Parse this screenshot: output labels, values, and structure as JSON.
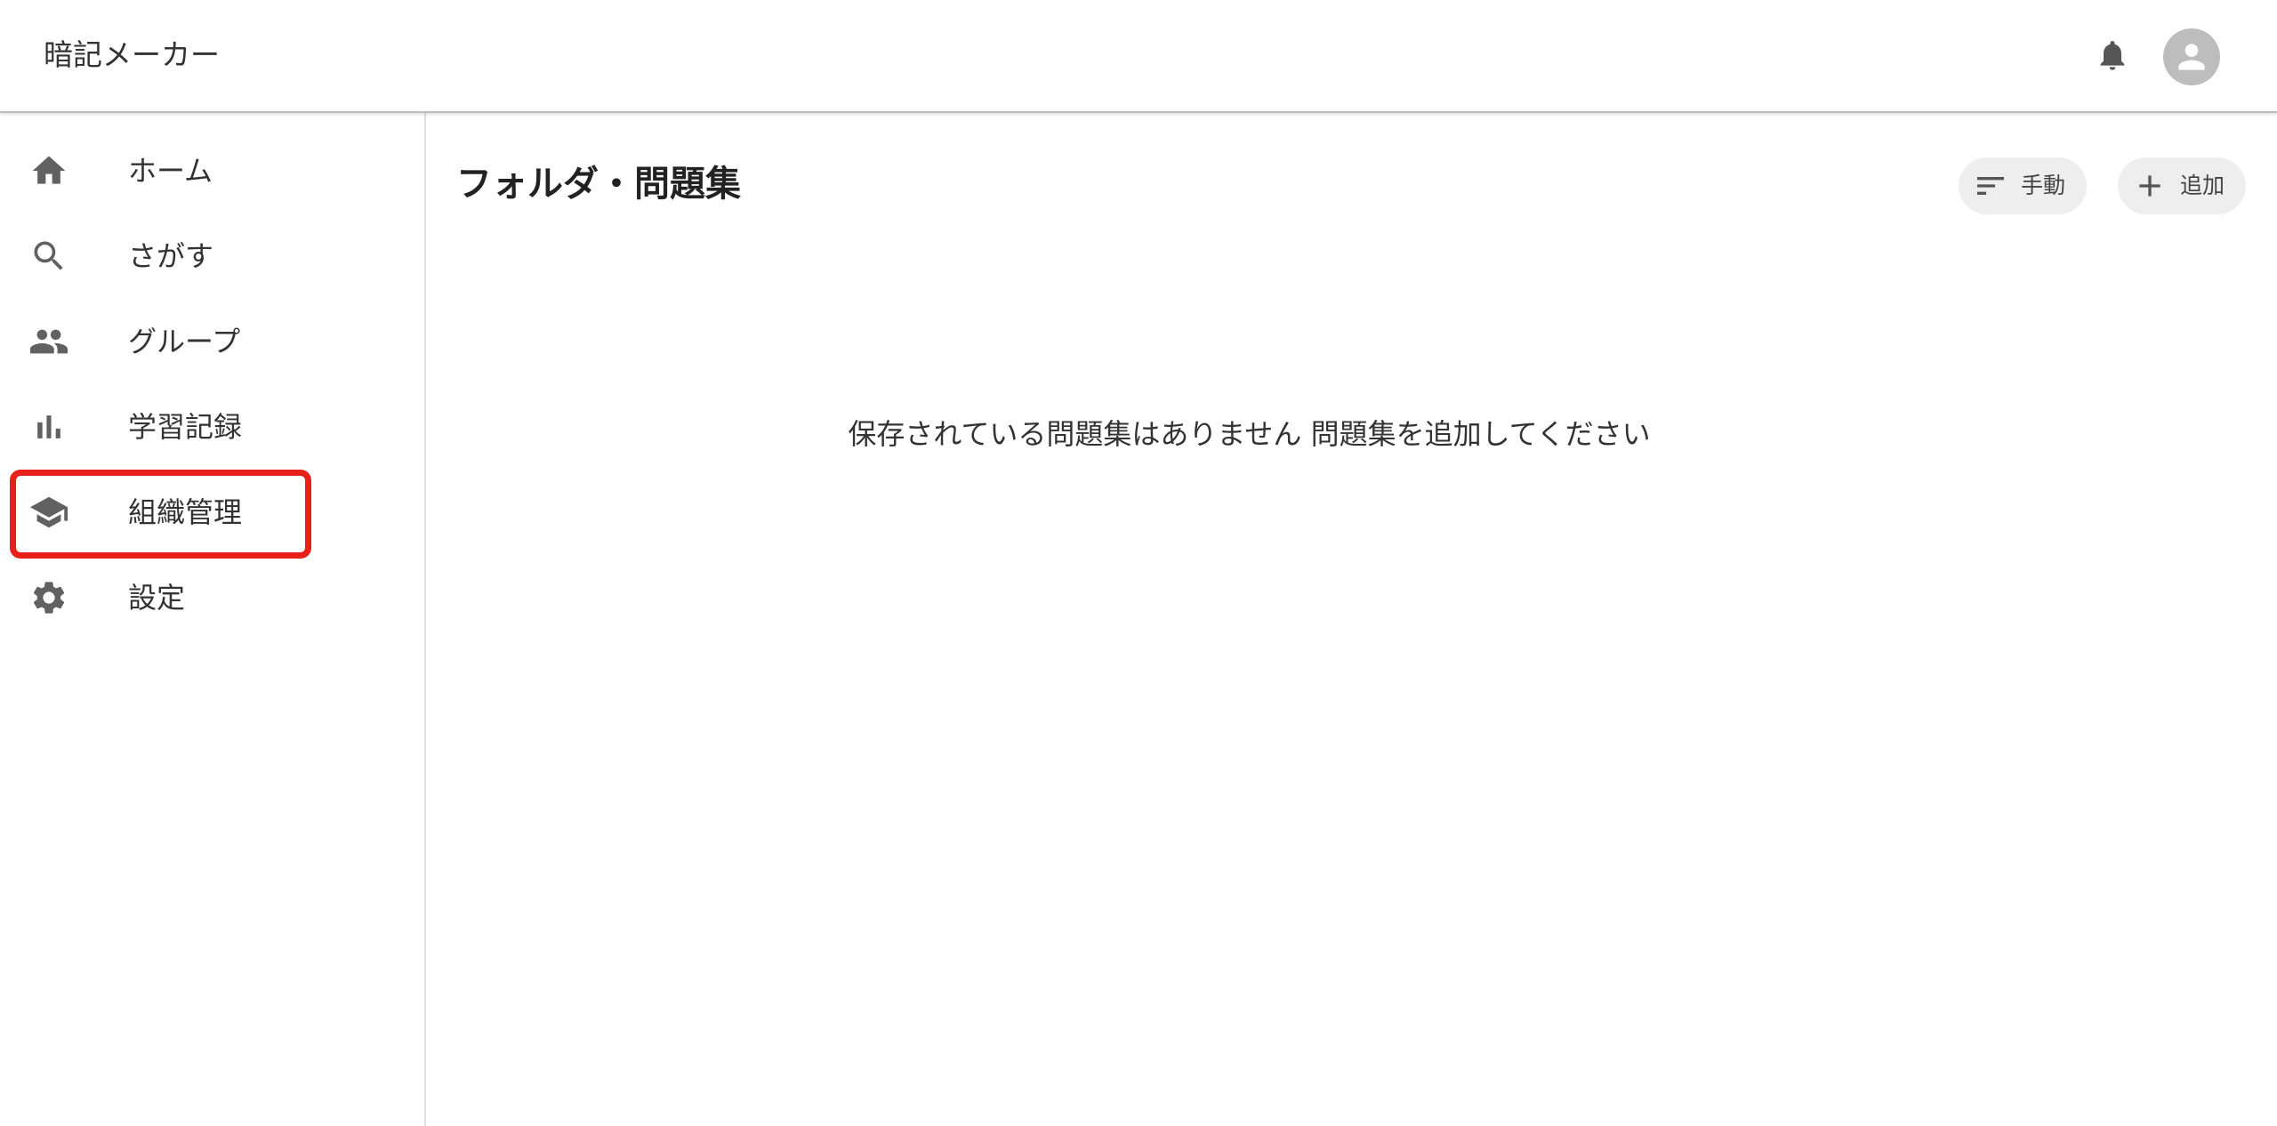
{
  "header": {
    "app_title": "暗記メーカー",
    "notification_icon": "bell-icon",
    "account_icon": "account-circle-icon"
  },
  "sidebar": {
    "items": [
      {
        "label": "ホーム",
        "icon": "home-icon"
      },
      {
        "label": "さがす",
        "icon": "search-icon"
      },
      {
        "label": "グループ",
        "icon": "people-icon"
      },
      {
        "label": "学習記録",
        "icon": "bar-chart-icon"
      },
      {
        "label": "組織管理",
        "icon": "school-icon",
        "highlighted": true
      },
      {
        "label": "設定",
        "icon": "gear-icon"
      }
    ]
  },
  "main": {
    "title": "フォルダ・問題集",
    "sort_button": {
      "label": "手動",
      "icon": "sort-icon"
    },
    "add_button": {
      "label": "追加",
      "icon": "plus-icon"
    },
    "empty_message": "保存されている問題集はありません 問題集を追加してください"
  },
  "colors": {
    "highlight": "#e8201a",
    "icon": "#616161",
    "chip_background": "#eeeeee",
    "avatar_background": "#bdbdbd"
  }
}
